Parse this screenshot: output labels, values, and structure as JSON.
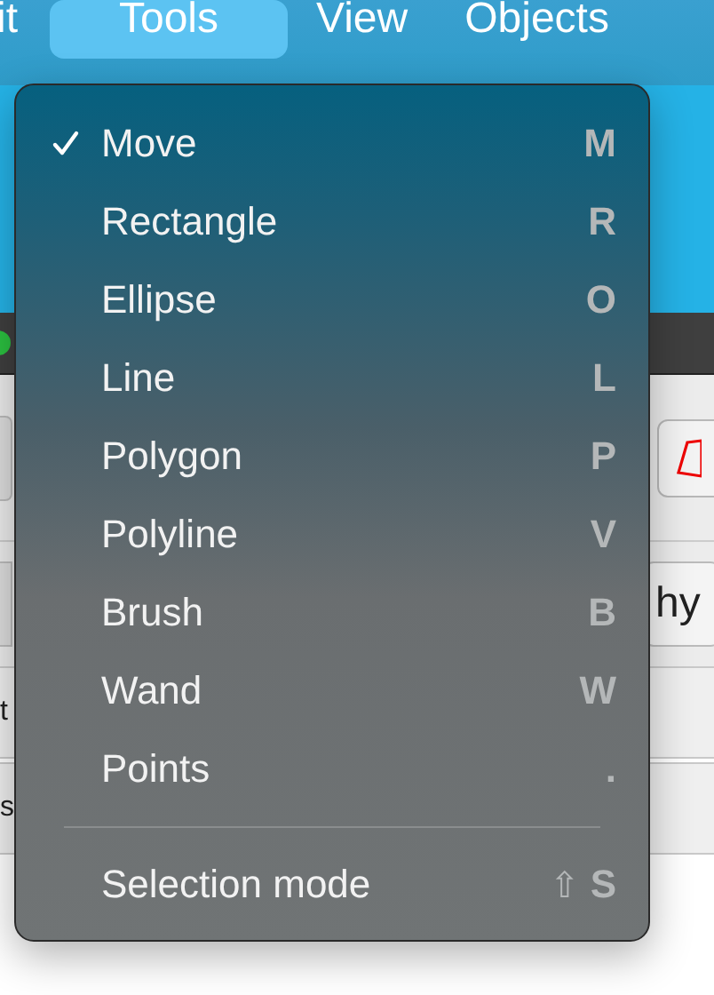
{
  "menu_bar": [
    {
      "label": "it",
      "selected": false
    },
    {
      "label": "Tools",
      "selected": true
    },
    {
      "label": "View",
      "selected": false
    },
    {
      "label": "Objects",
      "selected": false
    }
  ],
  "background": {
    "toolbar_button": {
      "kind": "polygon"
    },
    "button_label": "hy",
    "row_labels": [
      "t",
      "s"
    ]
  },
  "tools_menu": [
    {
      "kind": "item",
      "label": "Move",
      "shortcut": "M",
      "checked": true
    },
    {
      "kind": "item",
      "label": "Rectangle",
      "shortcut": "R",
      "checked": false
    },
    {
      "kind": "item",
      "label": "Ellipse",
      "shortcut": "O",
      "checked": false
    },
    {
      "kind": "item",
      "label": "Line",
      "shortcut": "L",
      "checked": false
    },
    {
      "kind": "item",
      "label": "Polygon",
      "shortcut": "P",
      "checked": false
    },
    {
      "kind": "item",
      "label": "Polyline",
      "shortcut": "V",
      "checked": false
    },
    {
      "kind": "item",
      "label": "Brush",
      "shortcut": "B",
      "checked": false
    },
    {
      "kind": "item",
      "label": "Wand",
      "shortcut": "W",
      "checked": false
    },
    {
      "kind": "item",
      "label": "Points",
      "shortcut": ".",
      "checked": false
    },
    {
      "kind": "separator"
    },
    {
      "kind": "item",
      "label": "Selection mode",
      "shortcut": "S",
      "modifier": "⇧",
      "checked": false
    }
  ]
}
